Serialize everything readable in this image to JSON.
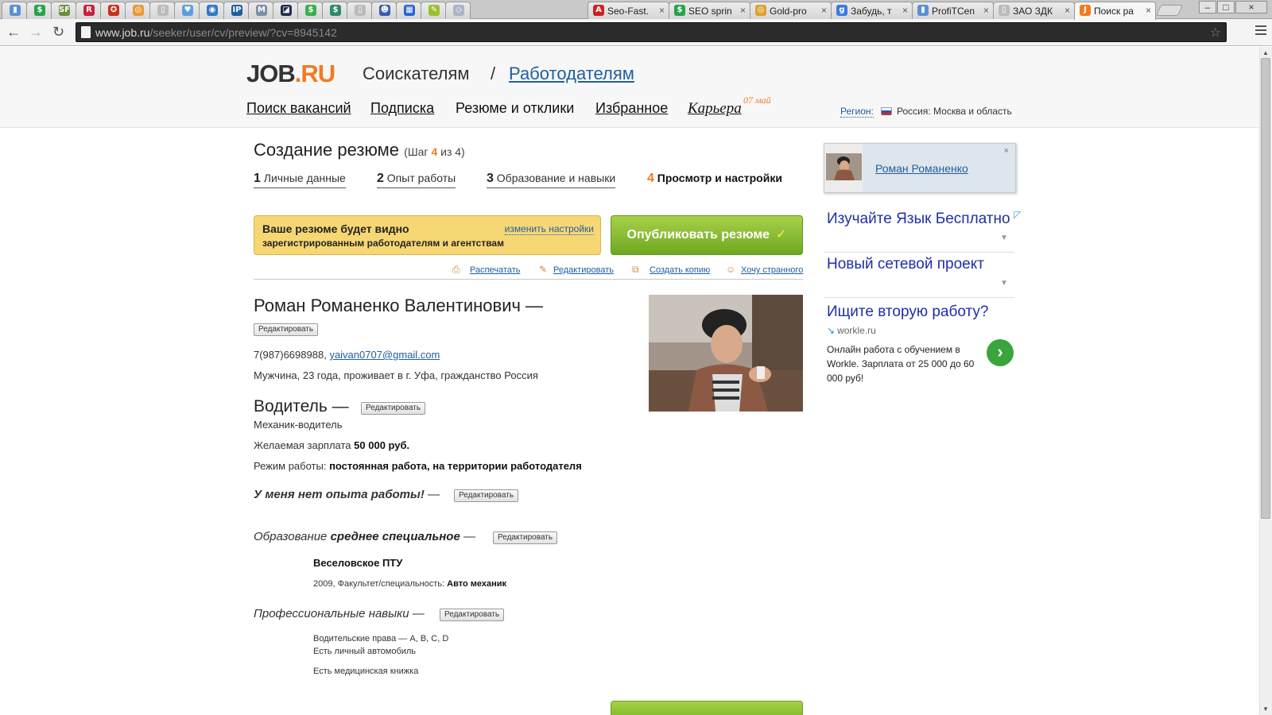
{
  "browser": {
    "pinned_tabs": [
      {
        "icon": "bar-chart-icon",
        "glyph": "▮",
        "color": "#5a8fd8"
      },
      {
        "icon": "dollar-icon",
        "glyph": "$",
        "color": "#27a34a"
      },
      {
        "icon": "sf-icon",
        "glyph": "SF",
        "color": "#6b8e3a"
      },
      {
        "icon": "r-icon",
        "glyph": "R",
        "color": "#c9223b"
      },
      {
        "icon": "emblem-icon",
        "glyph": "✪",
        "color": "#c4321c"
      },
      {
        "icon": "swirl-icon",
        "glyph": "◎",
        "color": "#e59a3a"
      },
      {
        "icon": "page-icon",
        "glyph": "▯",
        "color": "#bbbbbb"
      },
      {
        "icon": "heart-icon",
        "glyph": "♥",
        "color": "#5aa0e0"
      },
      {
        "icon": "globe-icon",
        "glyph": "◉",
        "color": "#2e78c8"
      },
      {
        "icon": "ip-icon",
        "glyph": "IP",
        "color": "#1f5fa0"
      },
      {
        "icon": "m-icon",
        "glyph": "M",
        "color": "#7c8ea8"
      },
      {
        "icon": "dark-square-icon",
        "glyph": "◪",
        "color": "#222e50"
      },
      {
        "icon": "coin-icon",
        "glyph": "$",
        "color": "#3ab04a"
      },
      {
        "icon": "dollar-box-icon",
        "glyph": "$",
        "color": "#2f8a6a"
      },
      {
        "icon": "page-icon",
        "glyph": "▯",
        "color": "#bbbbbb"
      },
      {
        "icon": "robot-icon",
        "glyph": "☻",
        "color": "#3b5bb0"
      },
      {
        "icon": "grid-icon",
        "glyph": "▦",
        "color": "#2a63d6"
      },
      {
        "icon": "leaf-icon",
        "glyph": "✎",
        "color": "#9abf30"
      },
      {
        "icon": "diamond-icon",
        "glyph": "◇",
        "color": "#aab4c4"
      }
    ],
    "tabs": [
      {
        "title": "Seo-Fast.",
        "glyph": "A",
        "color": "#cc2222"
      },
      {
        "title": "SEO sprin",
        "glyph": "$",
        "color": "#27a34a"
      },
      {
        "title": "Gold-pro",
        "glyph": "◎",
        "color": "#e0a030"
      },
      {
        "title": "Забудь, т",
        "glyph": "g",
        "color": "#3a7ae0"
      },
      {
        "title": "ProfiTCen",
        "glyph": "▮",
        "color": "#5a8fd8"
      },
      {
        "title": "ЗАО ЗДК",
        "glyph": "▯",
        "color": "#bbbbbb"
      },
      {
        "title": "Поиск ра",
        "glyph": "J",
        "color": "#f47a20"
      }
    ],
    "close_glyph": "×",
    "url_host": "www.job.ru",
    "url_path": "/seeker/user/cv/preview/?cv=8945142",
    "window": {
      "minimize": "–",
      "maximize": "□",
      "close": "×"
    }
  },
  "header": {
    "logo_main": "JOB",
    "logo_dot": ".",
    "logo_tld": "RU",
    "seekers": "Соискателям",
    "separator": "/",
    "employers": "Работодателям",
    "menu": {
      "search": "Поиск вакансий",
      "subscription": "Подписка",
      "resumes": "Резюме и отклики",
      "favorites": "Избранное",
      "career": "Карьера",
      "career_date": "07 май"
    },
    "region_label": "Регион:",
    "region_value": "Россия: Москва и область"
  },
  "wizard": {
    "title": "Создание резюме",
    "step_prefix": "(Шаг ",
    "step_current": "4",
    "step_suffix": " из 4)",
    "steps": [
      {
        "num": "1",
        "label": "Личные данные"
      },
      {
        "num": "2",
        "label": "Опыт работы"
      },
      {
        "num": "3",
        "label": "Образование и навыки"
      },
      {
        "num": "4",
        "label": "Просмотр и настройки"
      }
    ]
  },
  "visibility": {
    "title": "Ваше резюме будет видно",
    "subtitle": "зарегистрированным работодателям и агентствам",
    "change_link": "изменить настройки"
  },
  "publish_label": "Опубликовать резюме",
  "publish_check": "✓",
  "actions": {
    "print": "Распечатать",
    "edit": "Редактировать",
    "copy": "Создать копию",
    "weird": "Хочу странного"
  },
  "resume": {
    "full_name": "Роман Романенко Валентинович —",
    "edit_label": "Редактировать",
    "phone": "7(987)6698988,",
    "email": "yaivan0707@gmail.com",
    "personal": "Мужчина, 23 года, проживает в г. Уфа, гражданство Россия",
    "position_title": "Водитель —",
    "position_sub": "Механик-водитель",
    "salary_label": "Желаемая зарплата ",
    "salary_value": "50 000 руб.",
    "mode_label": "Режим работы: ",
    "mode_value": "постоянная работа, на территории работодателя",
    "no_experience": "У меня нет опыта работы!",
    "dash": " —",
    "education_label": "Образование ",
    "education_value": "среднее специальное",
    "school": "Веселовское ПТУ",
    "school_details_prefix": "2009, Факультет/специальность: ",
    "school_details_value": "Авто механик",
    "skills_label": "Профессиональные навыки",
    "skills": [
      "Водительские права — A, B, C, D",
      "Есть личный автомобиль",
      "Есть медицинская книжка"
    ]
  },
  "sidebar": {
    "user_name": "Роман Романенко",
    "close": "×",
    "ads": [
      {
        "title": "Изучайте Язык Бесплатно"
      },
      {
        "title": "Новый сетевой проект"
      }
    ],
    "ad_arrow": "▼",
    "ad_corner": "◸",
    "ad3": {
      "title": "Ищите вторую работу?",
      "domain": "workle.ru",
      "desc": "Онлайн работа с обучением в Workle. Зарплата от 25 000 до 60 000 руб!",
      "go": "›"
    }
  }
}
